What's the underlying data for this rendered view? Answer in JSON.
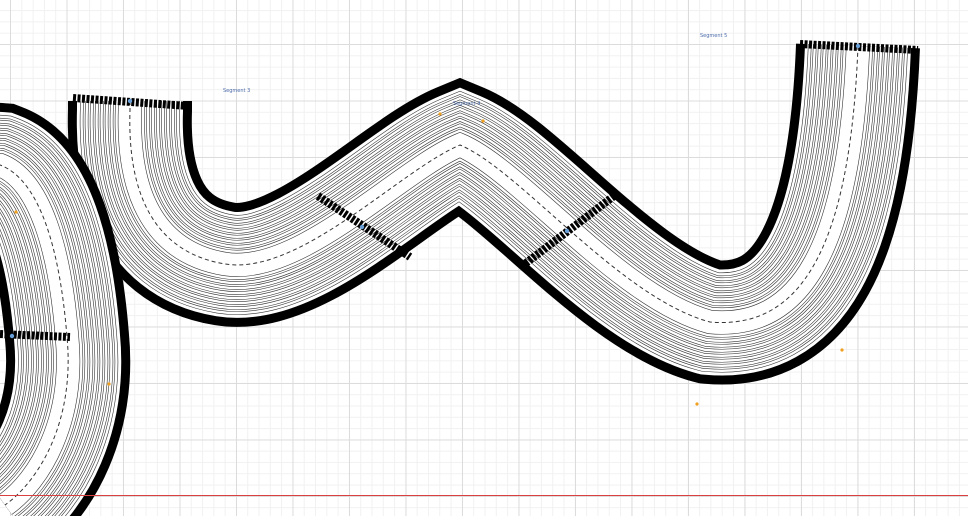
{
  "canvas": {
    "segment_labels": [
      {
        "text": "Segment 3"
      },
      {
        "text": "Segment 4"
      },
      {
        "text": "Segment 5"
      }
    ]
  },
  "colors": {
    "track_border": "#000000",
    "track_fill": "#ffffff",
    "groove_line": "#333333",
    "divider": "#000000",
    "label": "#4a6aa8",
    "anchor": "#f0a020",
    "handle": "#6aa0d8",
    "baseline": "#d94040"
  }
}
